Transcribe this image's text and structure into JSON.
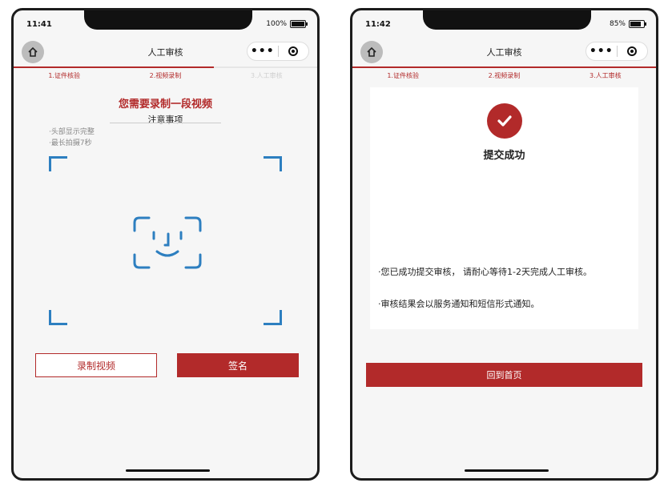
{
  "left_phone": {
    "status": {
      "time": "11:41",
      "battery": "100%",
      "battery_level": 1.0
    },
    "nav": {
      "title": "人工审核",
      "home_icon": "home-icon",
      "more_icon": "more-dots-icon",
      "target_icon": "target-icon"
    },
    "progress_fraction": 0.66,
    "steps": [
      "1.证件核验",
      "2.视频录制",
      "3.人工审核"
    ],
    "headline": "您需要录制一段视频",
    "notes_title": "注意事项",
    "notes": [
      "·头部显示完整",
      "·最长拍摄7秒"
    ],
    "face_icon": "face-id-icon",
    "buttons": {
      "record": "录制视频",
      "sign": "签名"
    },
    "colors": {
      "accent": "#b22a2a",
      "frame": "#2d7fc0"
    }
  },
  "right_phone": {
    "status": {
      "time": "11:42",
      "battery": "85%",
      "battery_level": 0.85
    },
    "nav": {
      "title": "人工审核",
      "home_icon": "home-icon",
      "more_icon": "more-dots-icon",
      "target_icon": "target-icon"
    },
    "progress_fraction": 1.0,
    "steps": [
      "1.证件核验",
      "2.视频录制",
      "3.人工审核"
    ],
    "success_icon": "check-circle-icon",
    "success_title": "提交成功",
    "messages": [
      "·您已成功提交审核， 请耐心等待1-2天完成人工审核。",
      "·审核结果会以服务通知和短信形式通知。"
    ],
    "button_home": "回到首页"
  }
}
